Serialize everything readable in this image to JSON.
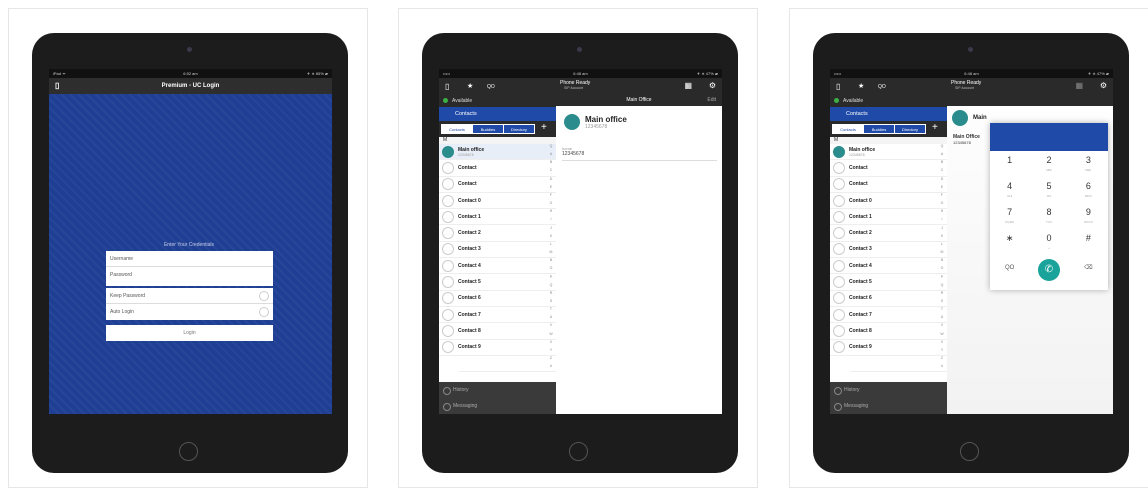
{
  "login": {
    "status": {
      "left": "iPad ᯤ",
      "time": "6:52 am",
      "right": "✈ ∗ 85% ▰"
    },
    "title": "Premium - UC Login",
    "prompt": "Enter Your Credentials",
    "username_placeholder": "Username",
    "password_placeholder": "Password",
    "keep_password": "Keep Password",
    "auto_login": "Auto Login",
    "login_button": "Login"
  },
  "app": {
    "status": {
      "left": "•••••",
      "time": "6:48 am",
      "right": "✈ ∗ 47% ▰"
    },
    "phone_ready": "Phone Ready",
    "sip_account": "SIP Account",
    "presence": "Available",
    "contacts_header": "Contacts",
    "tabs": [
      "Contacts",
      "Buddies",
      "Directory"
    ],
    "section_letter": "M",
    "contacts": [
      {
        "name": "Main office",
        "sub": "12345678"
      },
      {
        "name": "Contact",
        "sub": ""
      },
      {
        "name": "Contact",
        "sub": ""
      },
      {
        "name": "Contact 0",
        "sub": ""
      },
      {
        "name": "Contact 1",
        "sub": ""
      },
      {
        "name": "Contact 2",
        "sub": ""
      },
      {
        "name": "Contact 3",
        "sub": ""
      },
      {
        "name": "Contact 4",
        "sub": ""
      },
      {
        "name": "Contact 5",
        "sub": ""
      },
      {
        "name": "Contact 6",
        "sub": ""
      },
      {
        "name": "Contact 7",
        "sub": ""
      },
      {
        "name": "Contact 8",
        "sub": ""
      },
      {
        "name": "Contact 9",
        "sub": ""
      }
    ],
    "index": [
      "Q",
      "A",
      "B",
      "C",
      "D",
      "E",
      "F",
      "G",
      "H",
      "I",
      "J",
      "K",
      "L",
      "M",
      "N",
      "O",
      "P",
      "Q",
      "R",
      "S",
      "T",
      "U",
      "V",
      "W",
      "X",
      "Y",
      "Z",
      "#"
    ],
    "footer": [
      "History",
      "Messaging"
    ],
    "detail_header": "Main Office",
    "edit": "Edit",
    "detail_name": "Main office",
    "detail_phone": "12345678",
    "detail_label": "home",
    "detail_number": "12345678"
  },
  "dialer": {
    "detail_name_short": "Main",
    "detail_sub_name": "Main Office",
    "detail_sub_phone": "12345678",
    "keys": [
      {
        "d": "1",
        "l": ""
      },
      {
        "d": "2",
        "l": "ABC"
      },
      {
        "d": "3",
        "l": "DEF"
      },
      {
        "d": "4",
        "l": "GHI"
      },
      {
        "d": "5",
        "l": "JKL"
      },
      {
        "d": "6",
        "l": "MNO"
      },
      {
        "d": "7",
        "l": "PQRS"
      },
      {
        "d": "8",
        "l": "TUV"
      },
      {
        "d": "9",
        "l": "WXYZ"
      },
      {
        "d": "∗",
        "l": ""
      },
      {
        "d": "0",
        "l": "+"
      },
      {
        "d": "#",
        "l": ""
      }
    ]
  }
}
